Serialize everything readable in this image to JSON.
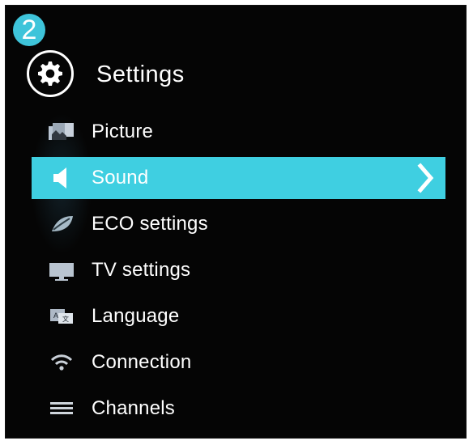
{
  "step_number": "2",
  "header": {
    "title": "Settings",
    "icon": "gear-icon"
  },
  "menu": {
    "items": [
      {
        "label": "Picture",
        "icon": "picture-icon",
        "selected": false
      },
      {
        "label": "Sound",
        "icon": "speaker-icon",
        "selected": true
      },
      {
        "label": "ECO settings",
        "icon": "leaf-icon",
        "selected": false
      },
      {
        "label": "TV settings",
        "icon": "tv-icon",
        "selected": false
      },
      {
        "label": "Language",
        "icon": "language-icon",
        "selected": false
      },
      {
        "label": "Connection",
        "icon": "wifi-icon",
        "selected": false
      },
      {
        "label": "Channels",
        "icon": "channels-icon",
        "selected": false
      }
    ]
  },
  "colors": {
    "background": "#050505",
    "highlight": "#3fcfe1",
    "badge": "#3ec4da",
    "text": "#ffffff"
  }
}
